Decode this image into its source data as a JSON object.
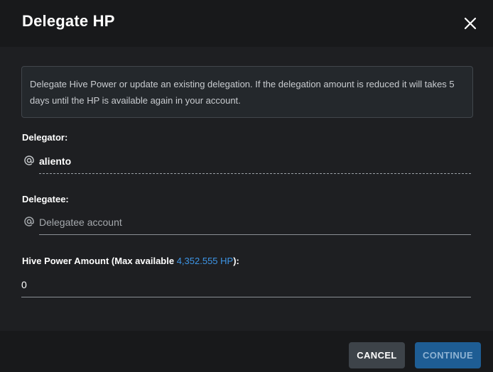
{
  "dialog": {
    "title": "Delegate HP",
    "close_icon": "close-icon"
  },
  "info": {
    "text": "Delegate Hive Power or update an existing delegation. If the delegation amount is reduced it will takes 5 days until the HP is available again in your account."
  },
  "delegator": {
    "label": "Delegator:",
    "icon": "at-icon",
    "value": "aliento"
  },
  "delegatee": {
    "label": "Delegatee:",
    "icon": "at-icon",
    "placeholder": "Delegatee account",
    "value": ""
  },
  "amount": {
    "label_prefix": "Hive Power Amount (Max available ",
    "max_available": "4,352.555 HP",
    "label_suffix": "):",
    "value": "0"
  },
  "buttons": {
    "cancel": "CANCEL",
    "continue": "CONTINUE"
  },
  "colors": {
    "background": "#1e1f22",
    "accent": "#3d95e6",
    "continue_button": "#1e5d94",
    "cancel_button": "#3d4349"
  }
}
